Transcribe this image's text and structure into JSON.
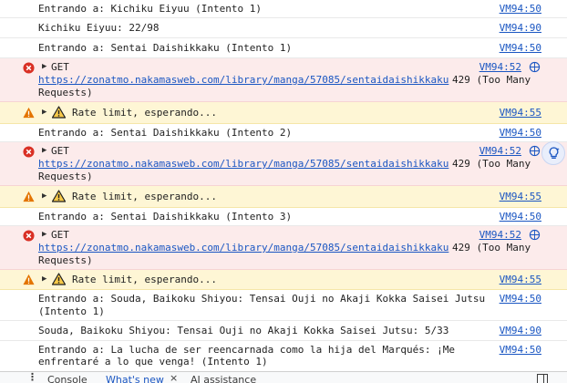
{
  "console": {
    "rows": [
      {
        "type": "log",
        "text": "Entrando a: Kichiku Eiyuu (Intento 1)",
        "source": "VM94:50"
      },
      {
        "type": "log",
        "text": "Kichiku Eiyuu: 22/98",
        "source": "VM94:90"
      },
      {
        "type": "log",
        "text": "Entrando a: Sentai Daishikkaku (Intento 1)",
        "source": "VM94:50"
      },
      {
        "type": "error",
        "method": "GET",
        "url": "https://zonatmo.nakamasweb.com/library/manga/57085/sentaidaishikkaku",
        "status": "429 (Too Many",
        "status2": "Requests)",
        "source": "VM94:52"
      },
      {
        "type": "warn",
        "text": "Rate limit, esperando...",
        "source": "VM94:55"
      },
      {
        "type": "log",
        "text": "Entrando a: Sentai Daishikkaku (Intento 2)",
        "source": "VM94:50"
      },
      {
        "type": "error",
        "method": "GET",
        "url": "https://zonatmo.nakamasweb.com/library/manga/57085/sentaidaishikkaku",
        "status": "429 (Too Many",
        "status2": "Requests)",
        "source": "VM94:52"
      },
      {
        "type": "warn",
        "text": "Rate limit, esperando...",
        "source": "VM94:55"
      },
      {
        "type": "log",
        "text": "Entrando a: Sentai Daishikkaku (Intento 3)",
        "source": "VM94:50"
      },
      {
        "type": "error",
        "method": "GET",
        "url": "https://zonatmo.nakamasweb.com/library/manga/57085/sentaidaishikkaku",
        "status": "429 (Too Many",
        "status2": "Requests)",
        "source": "VM94:52"
      },
      {
        "type": "warn",
        "text": "Rate limit, esperando...",
        "source": "VM94:55"
      },
      {
        "type": "log",
        "text": "Entrando a: Souda, Baikoku Shiyou: Tensai Ouji no Akaji Kokka Saisei Jutsu",
        "text2": "(Intento 1)",
        "source": "VM94:50"
      },
      {
        "type": "log",
        "text": "Souda, Baikoku Shiyou: Tensai Ouji no Akaji Kokka Saisei Jutsu: 5/33",
        "source": "VM94:90"
      },
      {
        "type": "log",
        "text": "Entrando a: La lucha de ser reencarnada como la hija del Marqués: ¡Me",
        "text2": "enfrentaré a lo que venga! (Intento 1)",
        "source": "VM94:50"
      }
    ]
  },
  "drawer": {
    "tabs": [
      {
        "label": "Console",
        "active": false
      },
      {
        "label": "What's new",
        "active": true
      },
      {
        "label": "AI assistance",
        "active": false
      }
    ],
    "close_glyph": "×"
  },
  "colors": {
    "error_bg": "#fcebeb",
    "warn_bg": "#fef6d5",
    "link": "#1a56c2",
    "error_icon": "#d93025",
    "warn_icon": "#e37400"
  }
}
